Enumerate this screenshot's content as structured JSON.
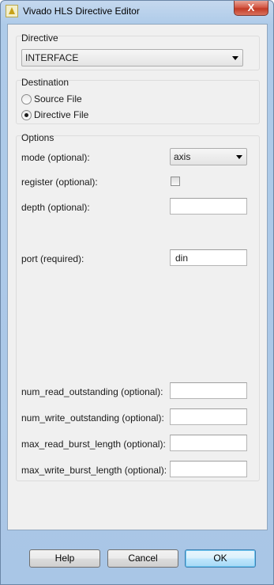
{
  "window": {
    "title": "Vivado HLS Directive Editor",
    "close_symbol": "X"
  },
  "directive": {
    "group_label": "Directive",
    "selected": "INTERFACE"
  },
  "destination": {
    "group_label": "Destination",
    "options": [
      {
        "label": "Source File",
        "checked": false
      },
      {
        "label": "Directive File",
        "checked": true
      }
    ]
  },
  "options": {
    "group_label": "Options",
    "mode": {
      "label": "mode (optional):",
      "value": "axis"
    },
    "register": {
      "label": "register (optional):",
      "checked": false
    },
    "depth": {
      "label": "depth (optional):",
      "value": ""
    },
    "port": {
      "label": "port (required):",
      "value": "din"
    },
    "num_read_outstanding": {
      "label": "num_read_outstanding (optional):",
      "value": ""
    },
    "num_write_outstanding": {
      "label": "num_write_outstanding (optional):",
      "value": ""
    },
    "max_read_burst_length": {
      "label": "max_read_burst_length (optional):",
      "value": ""
    },
    "max_write_burst_length": {
      "label": "max_write_burst_length (optional):",
      "value": ""
    }
  },
  "buttons": {
    "help": "Help",
    "cancel": "Cancel",
    "ok": "OK"
  }
}
